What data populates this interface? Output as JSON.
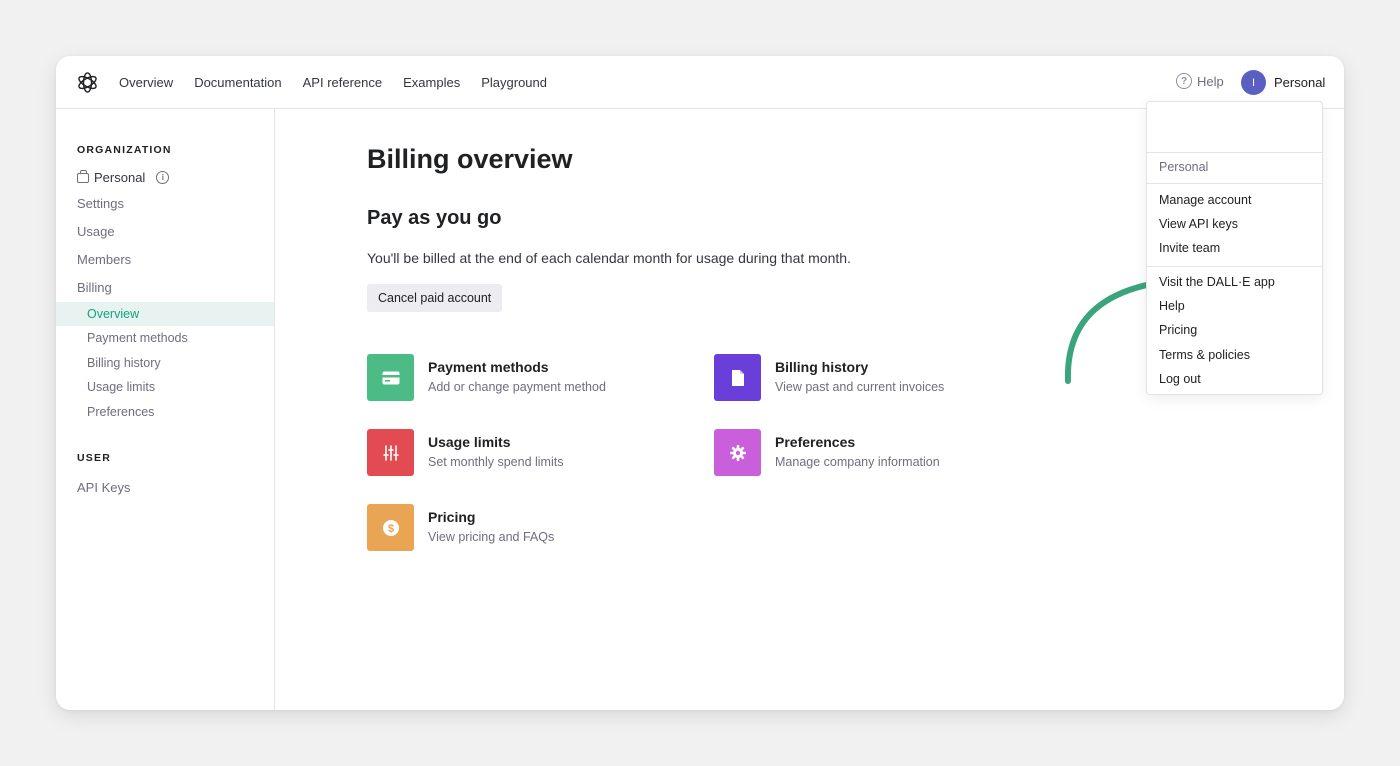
{
  "nav": {
    "links": [
      "Overview",
      "Documentation",
      "API reference",
      "Examples",
      "Playground"
    ],
    "help_label": "Help",
    "avatar_initial": "I",
    "account_label": "Personal"
  },
  "sidebar": {
    "org_heading": "ORGANIZATION",
    "org_name": "Personal",
    "items": [
      "Settings",
      "Usage",
      "Members",
      "Billing"
    ],
    "billing_sub": [
      "Overview",
      "Payment methods",
      "Billing history",
      "Usage limits",
      "Preferences"
    ],
    "user_heading": "USER",
    "user_items": [
      "API Keys"
    ]
  },
  "main": {
    "title": "Billing overview",
    "plan_title": "Pay as you go",
    "plan_desc": "You'll be billed at the end of each calendar month for usage during that month.",
    "cancel_label": "Cancel paid account",
    "cards": [
      {
        "title": "Payment methods",
        "desc": "Add or change payment method",
        "icon": "credit-card-icon",
        "color": "#4dbb85"
      },
      {
        "title": "Billing history",
        "desc": "View past and current invoices",
        "icon": "document-icon",
        "color": "#6a3fd9"
      },
      {
        "title": "Usage limits",
        "desc": "Set monthly spend limits",
        "icon": "sliders-icon",
        "color": "#e34b52"
      },
      {
        "title": "Preferences",
        "desc": "Manage company information",
        "icon": "gear-icon",
        "color": "#c95fdb"
      },
      {
        "title": "Pricing",
        "desc": "View pricing and FAQs",
        "icon": "dollar-icon",
        "color": "#e9a553"
      }
    ]
  },
  "dropdown": {
    "org_label": "Personal",
    "group1": [
      "Manage account",
      "View API keys",
      "Invite team"
    ],
    "group2": [
      "Visit the DALL·E app",
      "Help",
      "Pricing",
      "Terms & policies",
      "Log out"
    ]
  },
  "colors": {
    "accent": "#10a37f",
    "arrow": "#3aa57c",
    "avatar": "#5a5fc4"
  }
}
